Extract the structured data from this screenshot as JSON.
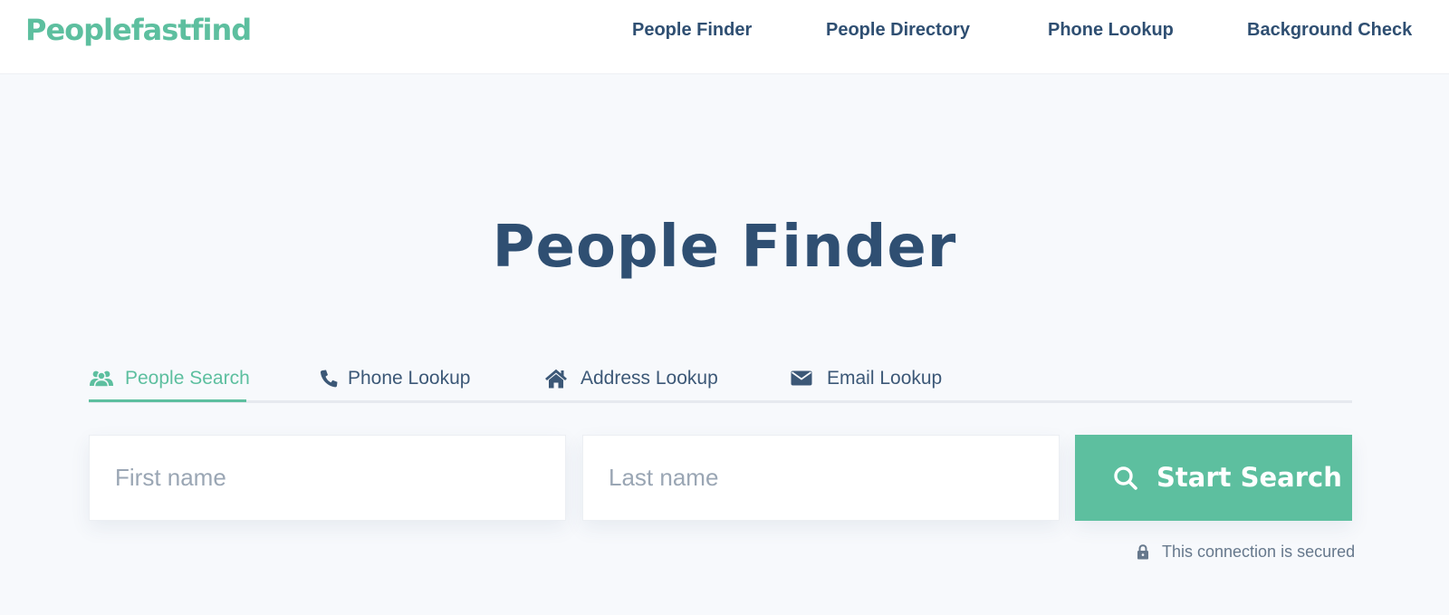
{
  "header": {
    "logo": "Peoplefastfind",
    "nav": [
      "People Finder",
      "People Directory",
      "Phone Lookup",
      "Background Check"
    ]
  },
  "hero": {
    "title": "People Finder"
  },
  "tabs": [
    {
      "label": "People Search",
      "icon": "people-icon",
      "active": true
    },
    {
      "label": "Phone Lookup",
      "icon": "phone-icon",
      "active": false
    },
    {
      "label": "Address Lookup",
      "icon": "home-icon",
      "active": false
    },
    {
      "label": "Email Lookup",
      "icon": "envelope-icon",
      "active": false
    }
  ],
  "form": {
    "first_name": {
      "placeholder": "First name",
      "value": ""
    },
    "last_name": {
      "placeholder": "Last name",
      "value": ""
    },
    "submit_label": "Start Search",
    "submit_icon": "search-icon"
  },
  "secure_note": {
    "icon": "lock-icon",
    "text": "This connection is secured"
  },
  "colors": {
    "accent": "#5dbf9f",
    "navy": "#2f4f72",
    "background": "#f7f9fc"
  }
}
